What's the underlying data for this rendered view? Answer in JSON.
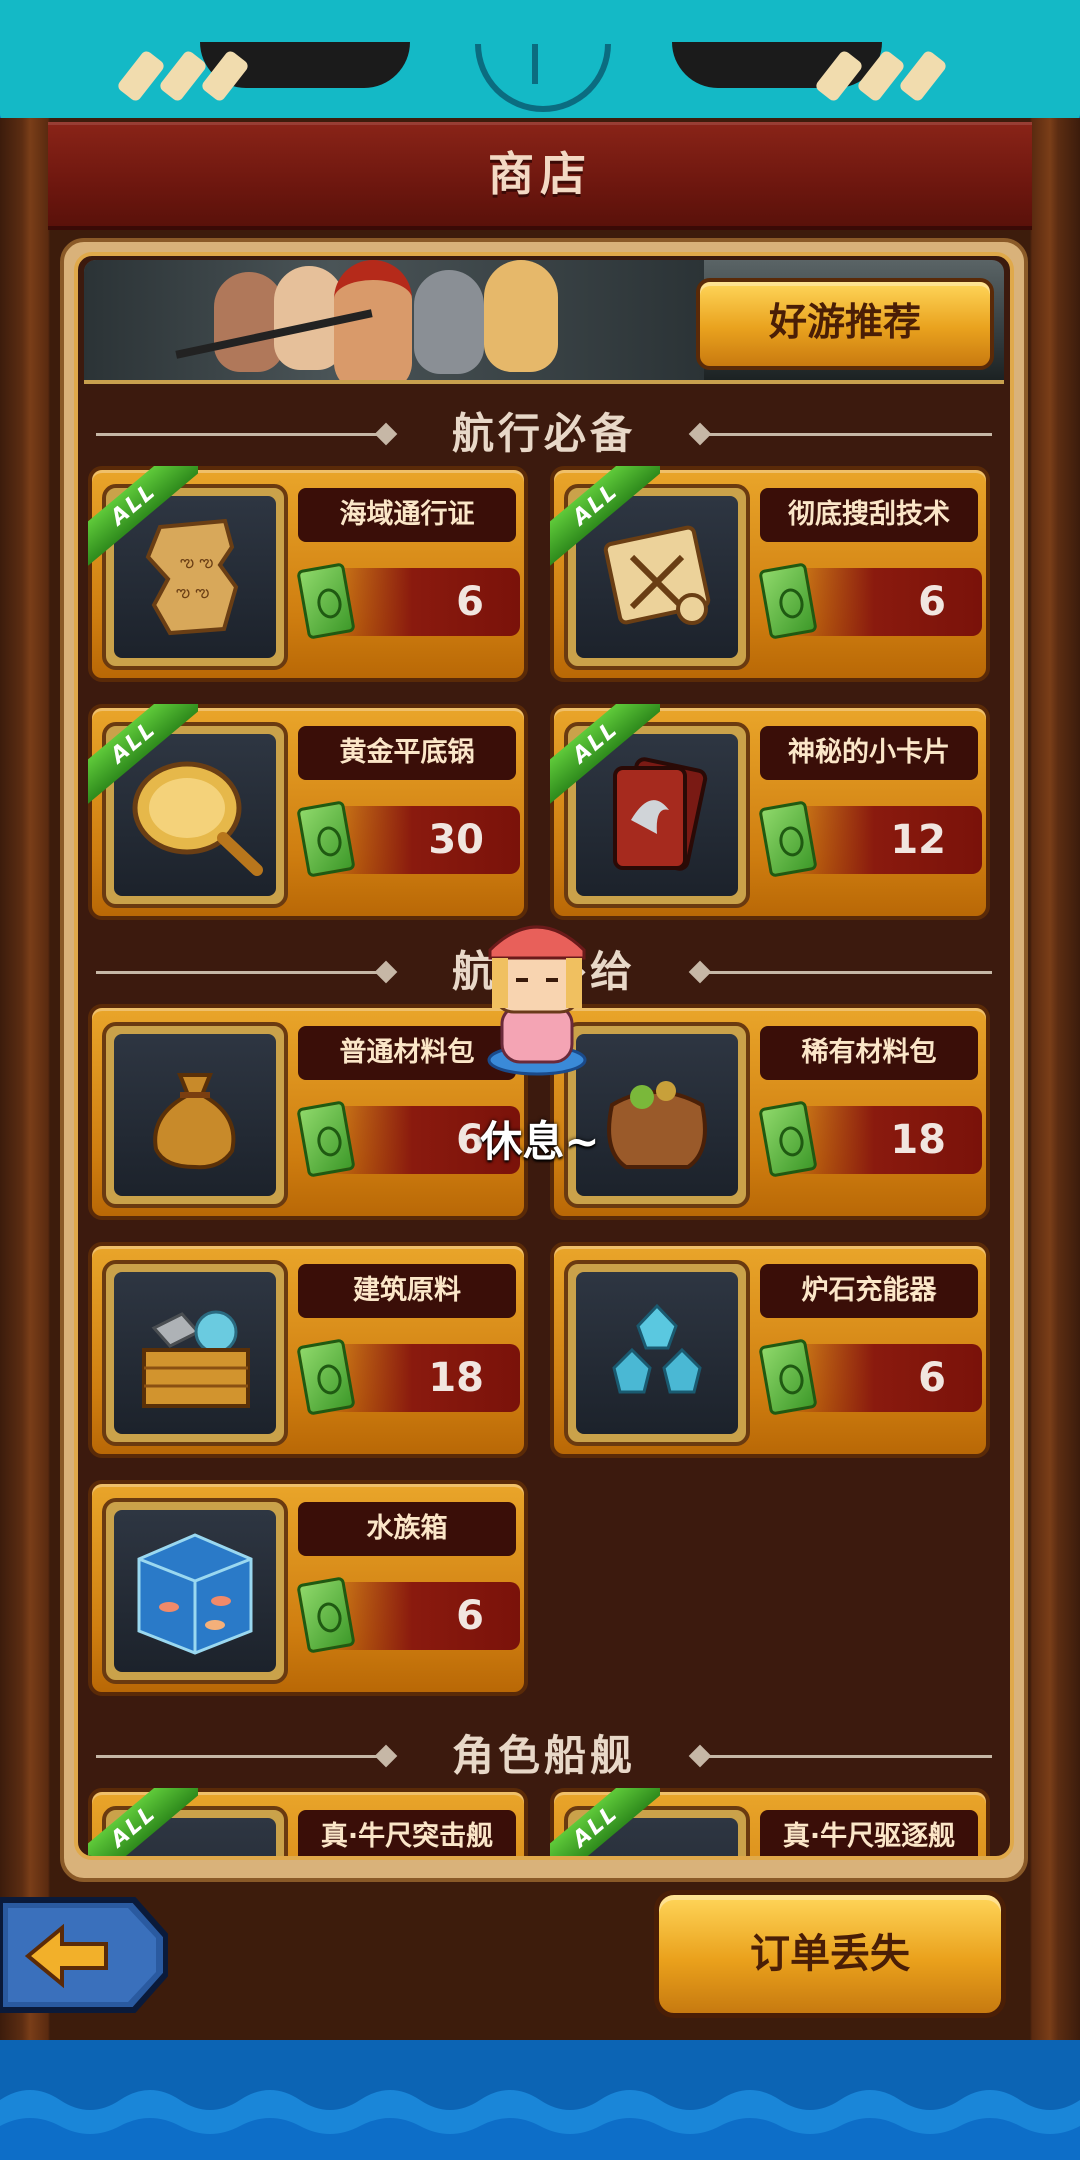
{
  "title": "商店",
  "banner": {
    "recommend_label": "好游推荐"
  },
  "sections": [
    {
      "label": "航行必备"
    },
    {
      "label": "航行补给"
    },
    {
      "label": "角色船舰"
    }
  ],
  "items": [
    {
      "name": "海域通行证",
      "price": "6",
      "tag": "ALL",
      "icon": "torn-map-icon"
    },
    {
      "name": "彻底搜刮技术",
      "price": "6",
      "tag": "ALL",
      "icon": "scroll-swords-icon"
    },
    {
      "name": "黄金平底锅",
      "price": "30",
      "tag": "ALL",
      "icon": "golden-frying-pan-icon"
    },
    {
      "name": "神秘的小卡片",
      "price": "12",
      "tag": "ALL",
      "icon": "dragon-card-icon"
    },
    {
      "name": "普通材料包",
      "price": "6",
      "icon": "material-sack-icon"
    },
    {
      "name": "稀有材料包",
      "price": "18",
      "icon": "rare-material-sack-icon"
    },
    {
      "name": "建筑原料",
      "price": "18",
      "icon": "building-crate-icon"
    },
    {
      "name": "炉石充能器",
      "price": "6",
      "icon": "crystal-charger-icon"
    },
    {
      "name": "水族箱",
      "price": "6",
      "icon": "aquarium-icon"
    },
    {
      "name": "真·牛尺突击舰",
      "tag": "ALL"
    },
    {
      "name": "真·牛尺驱逐舰",
      "tag": "ALL"
    }
  ],
  "pet": {
    "status": "休息~"
  },
  "bottom": {
    "order_label": "订单丢失",
    "back_icon": "back-arrow-icon"
  },
  "colors": {
    "accent": "#e9a52a",
    "panel": "#3c1a0e",
    "title_bar": "#7a1a10",
    "top_strip": "#14b9c6"
  }
}
